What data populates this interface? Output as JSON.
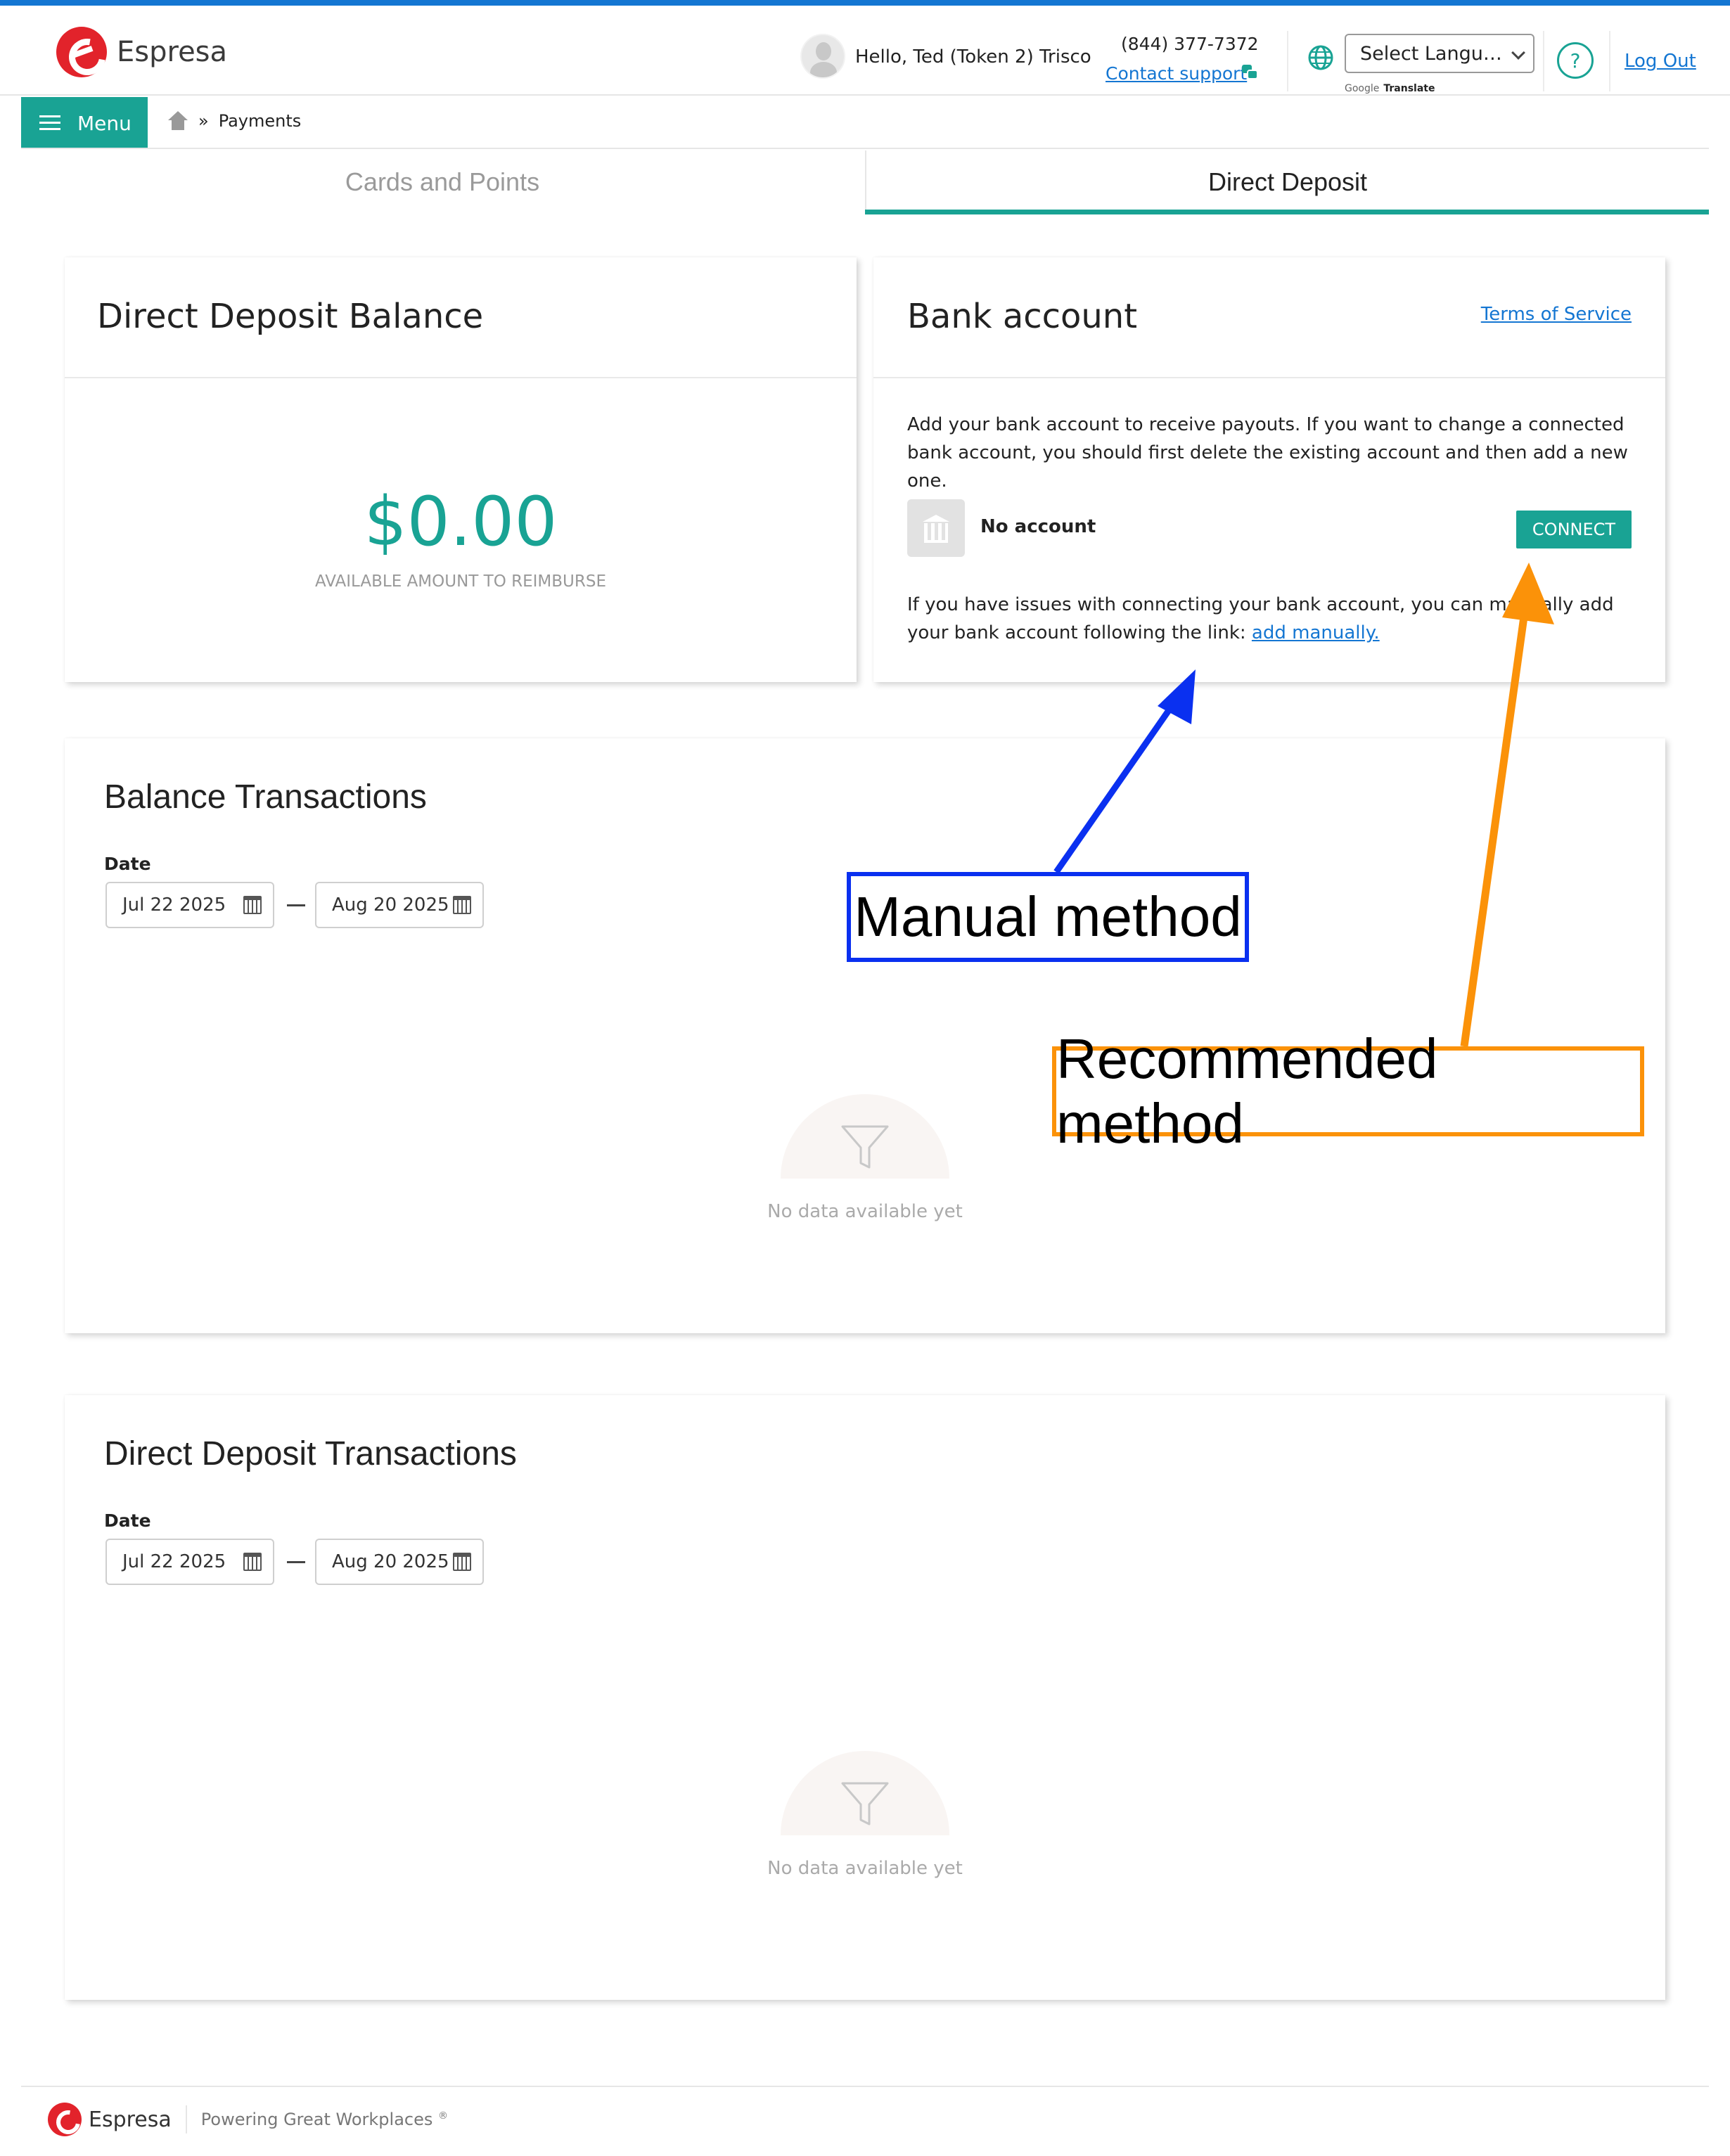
{
  "header": {
    "brand": "Espresa",
    "greeting": "Hello, Ted (Token 2) Trisco",
    "phone": "(844) 377-7372",
    "contact_support": "Contact support",
    "language_select": "Select Langu…",
    "google": "Google",
    "translate": "Translate",
    "help": "?",
    "logout": "Log Out"
  },
  "nav": {
    "menu_label": "Menu",
    "breadcrumb_sep": "»",
    "breadcrumb_current": "Payments"
  },
  "tabs": [
    {
      "label": "Cards and Points",
      "active": false
    },
    {
      "label": "Direct Deposit",
      "active": true
    }
  ],
  "balance_card": {
    "title": "Direct Deposit Balance",
    "amount": "$0.00",
    "subtitle": "AVAILABLE AMOUNT TO REIMBURSE"
  },
  "bank_card": {
    "title": "Bank account",
    "terms_link": "Terms of Service",
    "description": "Add your bank account to receive payouts. If you want to change a connected bank account, you should first delete the existing account and then add a new one.",
    "account_status": "No account",
    "connect_button": "CONNECT",
    "issue_text": "If you have issues with connecting your bank account, you can manually add your bank account following the link:",
    "add_manually_link": "add manually."
  },
  "balance_transactions": {
    "title": "Balance Transactions",
    "date_label": "Date",
    "date_from": "Jul 22 2025",
    "date_to": "Aug 20 2025",
    "empty_text": "No data available yet"
  },
  "deposit_transactions": {
    "title": "Direct Deposit Transactions",
    "date_label": "Date",
    "date_from": "Jul 22 2025",
    "date_to": "Aug 20 2025",
    "empty_text": "No data available yet"
  },
  "annotations": {
    "manual": "Manual method",
    "manual_color": "#0a30f0",
    "recommended": "Recommended method",
    "recommended_color": "#fb9209"
  },
  "footer": {
    "brand": "Espresa",
    "tagline": "Powering Great Workplaces",
    "registered": "®"
  },
  "colors": {
    "accent": "#19a394",
    "link": "#1476d2",
    "brand_red": "#e2232b"
  }
}
